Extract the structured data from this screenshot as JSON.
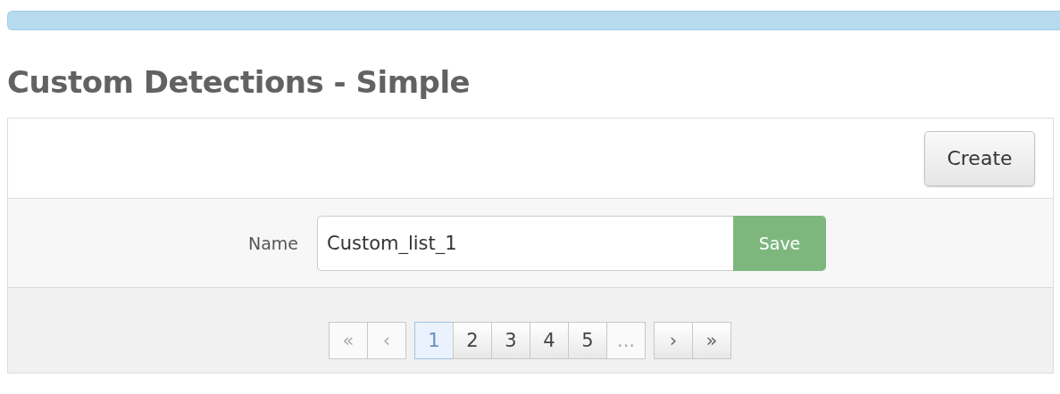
{
  "title": "Custom Detections - Simple",
  "toolbar": {
    "create_button": "Create"
  },
  "form": {
    "label": "Name",
    "value": "Custom_list_1",
    "save_button": "Save"
  },
  "pagination": {
    "groups": [
      [
        {
          "label": "«",
          "kind": "first",
          "selected": false,
          "disabled": true
        },
        {
          "label": "‹",
          "kind": "prev",
          "selected": false,
          "disabled": true
        }
      ],
      [
        {
          "label": "1",
          "kind": "page",
          "selected": true,
          "disabled": false
        },
        {
          "label": "2",
          "kind": "page",
          "selected": false,
          "disabled": false
        },
        {
          "label": "3",
          "kind": "page",
          "selected": false,
          "disabled": false
        },
        {
          "label": "4",
          "kind": "page",
          "selected": false,
          "disabled": false
        },
        {
          "label": "5",
          "kind": "page",
          "selected": false,
          "disabled": false
        },
        {
          "label": "...",
          "kind": "ellipsis",
          "selected": false,
          "disabled": true
        }
      ],
      [
        {
          "label": "›",
          "kind": "next",
          "selected": false,
          "disabled": false
        },
        {
          "label": "»",
          "kind": "last",
          "selected": false,
          "disabled": false
        }
      ]
    ]
  }
}
